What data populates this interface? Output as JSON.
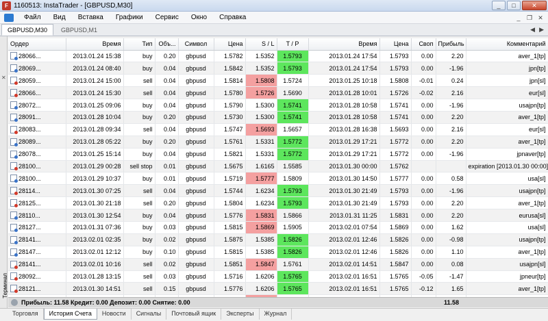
{
  "window": {
    "title": "1160513: InstaTrader - [GBPUSD,M30]"
  },
  "menu": [
    "Файл",
    "Вид",
    "Вставка",
    "Графики",
    "Сервис",
    "Окно",
    "Справка"
  ],
  "chart_tabs": [
    {
      "label": "GBPUSD,M30",
      "active": true
    },
    {
      "label": "GBPUSD,M1",
      "active": false
    }
  ],
  "columns": [
    "Ордер",
    "Время",
    "Тип",
    "Объ...",
    "Символ",
    "Цена",
    "S / L",
    "T / P",
    "Время",
    "Цена",
    "Своп",
    "Прибыль",
    "Комментарий"
  ],
  "rows": [
    {
      "order": "28066...",
      "open_time": "2013.01.24 15:38",
      "type": "buy",
      "volume": "0.20",
      "symbol": "gbpusd",
      "open_price": "1.5782",
      "sl": "1.5352",
      "tp": "1.5793",
      "close_time": "2013.01.24 17:54",
      "close_price": "1.5793",
      "swap": "0.00",
      "profit": "2.20",
      "comment": "aver_1[tp]",
      "hit": "tp"
    },
    {
      "order": "28069...",
      "open_time": "2013.01.24 08:40",
      "type": "buy",
      "volume": "0.04",
      "symbol": "gbpusd",
      "open_price": "1.5842",
      "sl": "1.5352",
      "tp": "1.5793",
      "close_time": "2013.01.24 17:54",
      "close_price": "1.5793",
      "swap": "0.00",
      "profit": "-1.96",
      "comment": "jpn[tp]",
      "hit": "tp"
    },
    {
      "order": "28059...",
      "open_time": "2013.01.24 15:00",
      "type": "sell",
      "volume": "0.04",
      "symbol": "gbpusd",
      "open_price": "1.5814",
      "sl": "1.5808",
      "tp": "1.5724",
      "close_time": "2013.01.25 10:18",
      "close_price": "1.5808",
      "swap": "-0.01",
      "profit": "0.24",
      "comment": "jpn[sl]",
      "hit": "sl"
    },
    {
      "order": "28066...",
      "open_time": "2013.01.24 15:30",
      "type": "sell",
      "volume": "0.04",
      "symbol": "gbpusd",
      "open_price": "1.5780",
      "sl": "1.5726",
      "tp": "1.5690",
      "close_time": "2013.01.28 10:01",
      "close_price": "1.5726",
      "swap": "-0.02",
      "profit": "2.16",
      "comment": "eur[sl]",
      "hit": "sl"
    },
    {
      "order": "28072...",
      "open_time": "2013.01.25 09:06",
      "type": "buy",
      "volume": "0.04",
      "symbol": "gbpusd",
      "open_price": "1.5790",
      "sl": "1.5300",
      "tp": "1.5741",
      "close_time": "2013.01.28 10:58",
      "close_price": "1.5741",
      "swap": "0.00",
      "profit": "-1.96",
      "comment": "usajpn[tp]",
      "hit": "tp"
    },
    {
      "order": "28091...",
      "open_time": "2013.01.28 10:04",
      "type": "buy",
      "volume": "0.20",
      "symbol": "gbpusd",
      "open_price": "1.5730",
      "sl": "1.5300",
      "tp": "1.5741",
      "close_time": "2013.01.28 10:58",
      "close_price": "1.5741",
      "swap": "0.00",
      "profit": "2.20",
      "comment": "aver_1[tp]",
      "hit": "tp"
    },
    {
      "order": "28083...",
      "open_time": "2013.01.28 09:34",
      "type": "sell",
      "volume": "0.04",
      "symbol": "gbpusd",
      "open_price": "1.5747",
      "sl": "1.5693",
      "tp": "1.5657",
      "close_time": "2013.01.28 16:38",
      "close_price": "1.5693",
      "swap": "0.00",
      "profit": "2.16",
      "comment": "eur[sl]",
      "hit": "sl"
    },
    {
      "order": "28089...",
      "open_time": "2013.01.28 05:22",
      "type": "buy",
      "volume": "0.20",
      "symbol": "gbpusd",
      "open_price": "1.5761",
      "sl": "1.5331",
      "tp": "1.5772",
      "close_time": "2013.01.29 17:21",
      "close_price": "1.5772",
      "swap": "0.00",
      "profit": "2.20",
      "comment": "aver_1[tp]",
      "hit": "tp"
    },
    {
      "order": "28078...",
      "open_time": "2013.01.25 15:14",
      "type": "buy",
      "volume": "0.04",
      "symbol": "gbpusd",
      "open_price": "1.5821",
      "sl": "1.5331",
      "tp": "1.5772",
      "close_time": "2013.01.29 17:21",
      "close_price": "1.5772",
      "swap": "0.00",
      "profit": "-1.96",
      "comment": "jpnaver[tp]",
      "hit": "tp"
    },
    {
      "order": "28100...",
      "open_time": "2013.01.29 00:28",
      "type": "sell stop",
      "volume": "0.01",
      "symbol": "gbpusd",
      "open_price": "1.5675",
      "sl": "1.6165",
      "tp": "1.5585",
      "close_time": "2013.01.30 00:00",
      "close_price": "1.5762",
      "swap": "",
      "profit": "",
      "comment": "expiration [2013.01.30 00:00]",
      "hit": ""
    },
    {
      "order": "28100...",
      "open_time": "2013.01.29 10:37",
      "type": "buy",
      "volume": "0.01",
      "symbol": "gbpusd",
      "open_price": "1.5719",
      "sl": "1.5777",
      "tp": "1.5809",
      "close_time": "2013.01.30 14:50",
      "close_price": "1.5777",
      "swap": "0.00",
      "profit": "0.58",
      "comment": "usa[sl]",
      "hit": "sl"
    },
    {
      "order": "28114...",
      "open_time": "2013.01.30 07:25",
      "type": "sell",
      "volume": "0.04",
      "symbol": "gbpusd",
      "open_price": "1.5744",
      "sl": "1.6234",
      "tp": "1.5793",
      "close_time": "2013.01.30 21:49",
      "close_price": "1.5793",
      "swap": "0.00",
      "profit": "-1.96",
      "comment": "usajpn[tp]",
      "hit": "tp"
    },
    {
      "order": "28125...",
      "open_time": "2013.01.30 21:18",
      "type": "sell",
      "volume": "0.20",
      "symbol": "gbpusd",
      "open_price": "1.5804",
      "sl": "1.6234",
      "tp": "1.5793",
      "close_time": "2013.01.30 21:49",
      "close_price": "1.5793",
      "swap": "0.00",
      "profit": "2.20",
      "comment": "aver_1[tp]",
      "hit": "tp"
    },
    {
      "order": "28110...",
      "open_time": "2013.01.30 12:54",
      "type": "buy",
      "volume": "0.04",
      "symbol": "gbpusd",
      "open_price": "1.5776",
      "sl": "1.5831",
      "tp": "1.5866",
      "close_time": "2013.01.31 11:25",
      "close_price": "1.5831",
      "swap": "0.00",
      "profit": "2.20",
      "comment": "eurusa[sl]",
      "hit": "sl"
    },
    {
      "order": "28127...",
      "open_time": "2013.01.31 07:36",
      "type": "buy",
      "volume": "0.03",
      "symbol": "gbpusd",
      "open_price": "1.5815",
      "sl": "1.5869",
      "tp": "1.5905",
      "close_time": "2013.02.01 07:54",
      "close_price": "1.5869",
      "swap": "0.00",
      "profit": "1.62",
      "comment": "usa[sl]",
      "hit": "sl"
    },
    {
      "order": "28141...",
      "open_time": "2013.02.01 02:35",
      "type": "buy",
      "volume": "0.02",
      "symbol": "gbpusd",
      "open_price": "1.5875",
      "sl": "1.5385",
      "tp": "1.5826",
      "close_time": "2013.02.01 12:46",
      "close_price": "1.5826",
      "swap": "0.00",
      "profit": "-0.98",
      "comment": "usajpn[tp]",
      "hit": "tp"
    },
    {
      "order": "28147...",
      "open_time": "2013.02.01 12:12",
      "type": "buy",
      "volume": "0.10",
      "symbol": "gbpusd",
      "open_price": "1.5815",
      "sl": "1.5385",
      "tp": "1.5826",
      "close_time": "2013.02.01 12:46",
      "close_price": "1.5826",
      "swap": "0.00",
      "profit": "1.10",
      "comment": "aver_1[tp]",
      "hit": "tp"
    },
    {
      "order": "28141...",
      "open_time": "2013.02.01 10:16",
      "type": "sell",
      "volume": "0.02",
      "symbol": "gbpusd",
      "open_price": "1.5851",
      "sl": "1.5847",
      "tp": "1.5761",
      "close_time": "2013.02.01 14:51",
      "close_price": "1.5847",
      "swap": "0.00",
      "profit": "0.08",
      "comment": "usajpn[sl]",
      "hit": "sl"
    },
    {
      "order": "28092...",
      "open_time": "2013.01.28 13:15",
      "type": "sell",
      "volume": "0.03",
      "symbol": "gbpusd",
      "open_price": "1.5716",
      "sl": "1.6206",
      "tp": "1.5765",
      "close_time": "2013.02.01 16:51",
      "close_price": "1.5765",
      "swap": "-0.05",
      "profit": "-1.47",
      "comment": "jpneur[tp]",
      "hit": "tp"
    },
    {
      "order": "28121...",
      "open_time": "2013.01.30 14:51",
      "type": "sell",
      "volume": "0.15",
      "symbol": "gbpusd",
      "open_price": "1.5776",
      "sl": "1.6206",
      "tp": "1.5765",
      "close_time": "2013.02.01 16:51",
      "close_price": "1.5765",
      "swap": "-0.12",
      "profit": "1.65",
      "comment": "aver_1[tp]",
      "hit": "tp"
    },
    {
      "order": "28149...",
      "open_time": "2013.02.01 16:18",
      "type": "sell",
      "volume": "0.02",
      "symbol": "gbpusd",
      "open_price": "1.5807",
      "sl": "1.5753",
      "tp": "1.5717",
      "close_time": "2013.02.01 17:35",
      "close_price": "1.5753",
      "swap": "0.00",
      "profit": "1.08",
      "comment": "eurusa[sl]",
      "hit": "sl"
    },
    {
      "order": "28149...",
      "open_time": "2013.02.01 15:28",
      "type": "buy stop",
      "volume": "0.02",
      "symbol": "gbpusd",
      "open_price": "1.5855",
      "sl": "1.5365",
      "tp": "1.5945",
      "close_time": "2013.02.01 18:53",
      "close_price": "1.5745",
      "swap": "",
      "profit": "",
      "comment": "cancelled",
      "hit": ""
    },
    {
      "order": "28153...",
      "open_time": "2013.02.01 17:29",
      "type": "sell",
      "volume": "0.04",
      "symbol": "gbpusd",
      "open_price": "1.5755",
      "sl": "1.6245",
      "tp": "1.5665",
      "close_time": "2013.02.01 18:53",
      "close_price": "1.5745",
      "swap": "0.00",
      "profit": "0.40",
      "comment": "eurusa",
      "hit": ""
    }
  ],
  "summary": {
    "text": "Прибыль: 11.58  Кредит: 0.00  Депозит: 0.00  Снятие: 0.00",
    "total": "11.58"
  },
  "side_label": "Терминал",
  "bottom_tabs": [
    {
      "label": "Торговля",
      "active": false
    },
    {
      "label": "История Счета",
      "active": true
    },
    {
      "label": "Новости",
      "active": false
    },
    {
      "label": "Сигналы",
      "active": false
    },
    {
      "label": "Почтовый ящик",
      "active": false
    },
    {
      "label": "Эксперты",
      "active": false
    },
    {
      "label": "Журнал",
      "active": false
    }
  ],
  "colors": {
    "sl_hit": "#f4a0a0",
    "tp_hit": "#5de65d"
  }
}
